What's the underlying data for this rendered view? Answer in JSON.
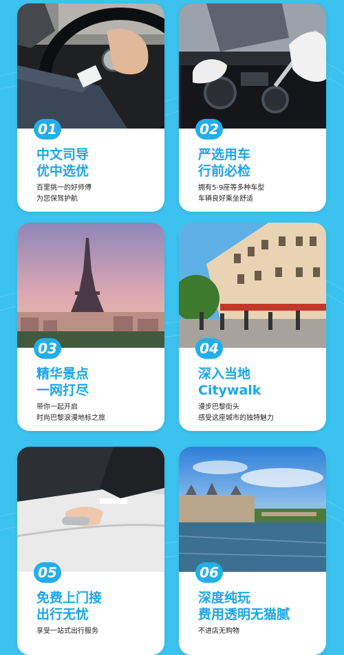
{
  "cards": [
    {
      "number": "01",
      "title_line1": "中文司导",
      "title_line2": "优中选优",
      "desc_line1": "百里挑一的好师傅",
      "desc_line2": "为您保驾护航"
    },
    {
      "number": "02",
      "title_line1": "严选用车",
      "title_line2": "行前必检",
      "desc_line1": "拥有5-9座等多种车型",
      "desc_line2": "车辆良好乘坐舒适"
    },
    {
      "number": "03",
      "title_line1": "精华景点",
      "title_line2": "一网打尽",
      "desc_line1": "带你一起开启",
      "desc_line2": "时尚巴黎浪漫地标之旅"
    },
    {
      "number": "04",
      "title_line1": "深入当地",
      "title_line2": "Citywalk",
      "desc_line1": "漫步巴黎街头",
      "desc_line2": "感受这座城市的独特魅力"
    },
    {
      "number": "05",
      "title_line1": "免费上门接",
      "title_line2": "出行无忧",
      "desc_line1": "享受一站式出行服务",
      "desc_line2": ""
    },
    {
      "number": "06",
      "title_line1": "深度纯玩",
      "title_line2": "费用透明无猫腻",
      "desc_line1": "不进店无购物",
      "desc_line2": ""
    }
  ],
  "colors": {
    "background": "#3cc2ee",
    "accent": "#1aa6e8",
    "badge": "#23aeea"
  }
}
